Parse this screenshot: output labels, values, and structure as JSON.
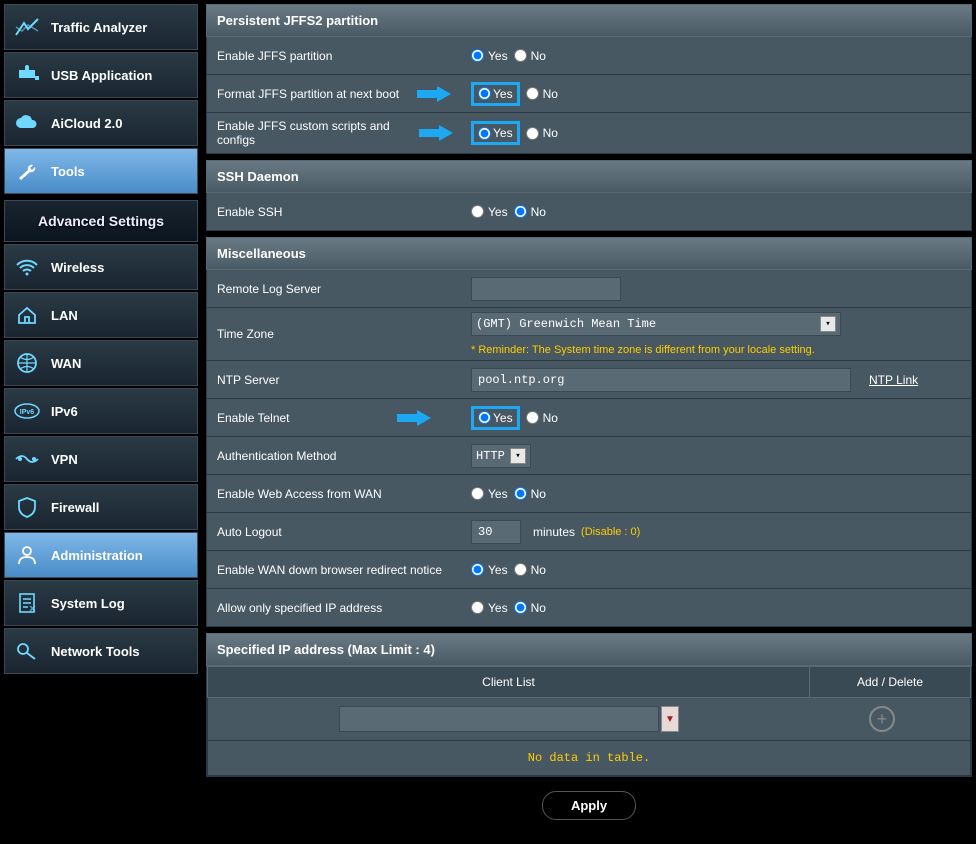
{
  "sidebar": {
    "primary": [
      {
        "label": "Traffic Analyzer",
        "icon": "chart-icon"
      },
      {
        "label": "USB Application",
        "icon": "puzzle-icon"
      },
      {
        "label": "AiCloud 2.0",
        "icon": "cloud-icon"
      },
      {
        "label": "Tools",
        "icon": "wrench-icon"
      }
    ],
    "advanced_title": "Advanced Settings",
    "advanced": [
      {
        "label": "Wireless",
        "icon": "wifi-icon"
      },
      {
        "label": "LAN",
        "icon": "home-icon"
      },
      {
        "label": "WAN",
        "icon": "globe-icon"
      },
      {
        "label": "IPv6",
        "icon": "ipv6-icon"
      },
      {
        "label": "VPN",
        "icon": "vpn-icon"
      },
      {
        "label": "Firewall",
        "icon": "shield-icon"
      },
      {
        "label": "Administration",
        "icon": "admin-icon"
      },
      {
        "label": "System Log",
        "icon": "log-icon"
      },
      {
        "label": "Network Tools",
        "icon": "nettools-icon"
      }
    ]
  },
  "sections": {
    "jffs": {
      "title": "Persistent JFFS2 partition",
      "rows": {
        "enable": {
          "label": "Enable JFFS partition",
          "value": "Yes"
        },
        "format": {
          "label": "Format JFFS partition at next boot",
          "value": "Yes"
        },
        "scripts": {
          "label": "Enable JFFS custom scripts and configs",
          "value": "Yes"
        }
      }
    },
    "ssh": {
      "title": "SSH Daemon",
      "rows": {
        "enable": {
          "label": "Enable SSH",
          "value": "No"
        }
      }
    },
    "misc": {
      "title": "Miscellaneous",
      "rows": {
        "remotelog": {
          "label": "Remote Log Server",
          "value": ""
        },
        "timezone": {
          "label": "Time Zone",
          "value": "(GMT) Greenwich Mean Time",
          "hint": "* Reminder: The System time zone is different from your locale setting."
        },
        "ntp": {
          "label": "NTP Server",
          "value": "pool.ntp.org",
          "link": "NTP Link"
        },
        "telnet": {
          "label": "Enable Telnet",
          "value": "Yes"
        },
        "auth": {
          "label": "Authentication Method",
          "value": "HTTP"
        },
        "webwan": {
          "label": "Enable Web Access from WAN",
          "value": "No"
        },
        "autologout": {
          "label": "Auto Logout",
          "value": "30",
          "suffix": "minutes",
          "hint2": "(Disable : 0)"
        },
        "wandown": {
          "label": "Enable WAN down browser redirect notice",
          "value": "Yes"
        },
        "specip": {
          "label": "Allow only specified IP address",
          "value": "No"
        }
      }
    },
    "iptable": {
      "title": "Specified IP address (Max Limit : 4)",
      "col1": "Client List",
      "col2": "Add / Delete",
      "empty": "No data in table."
    }
  },
  "labels": {
    "yes": "Yes",
    "no": "No",
    "apply": "Apply"
  }
}
